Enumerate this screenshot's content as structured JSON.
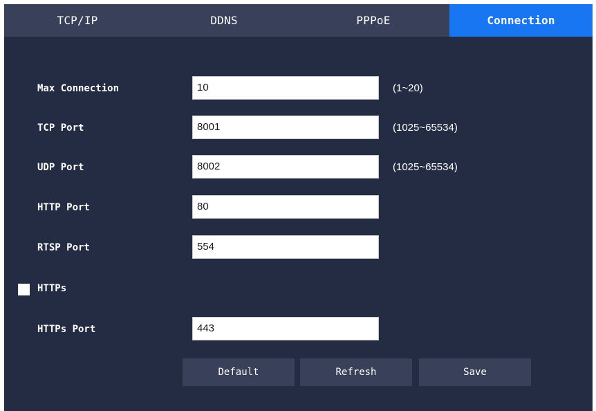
{
  "tabs": [
    {
      "label": "TCP/IP",
      "active": false
    },
    {
      "label": "DDNS",
      "active": false
    },
    {
      "label": "PPPoE",
      "active": false
    },
    {
      "label": "Connection",
      "active": true
    }
  ],
  "form": {
    "max_connection": {
      "label": "Max Connection",
      "value": "10",
      "range": "(1~20)"
    },
    "tcp_port": {
      "label": "TCP Port",
      "value": "8001",
      "range": "(1025~65534)"
    },
    "udp_port": {
      "label": "UDP Port",
      "value": "8002",
      "range": "(1025~65534)"
    },
    "http_port": {
      "label": "HTTP Port",
      "value": "80"
    },
    "rtsp_port": {
      "label": "RTSP Port",
      "value": "554"
    },
    "https": {
      "label": "HTTPs",
      "checked": false
    },
    "https_port": {
      "label": "HTTPs Port",
      "value": "443"
    }
  },
  "buttons": {
    "default": "Default",
    "refresh": "Refresh",
    "save": "Save"
  },
  "colors": {
    "background": "#232c42",
    "tab_bar": "#39415a",
    "active_tab": "#1876f2",
    "button": "#39415a"
  }
}
